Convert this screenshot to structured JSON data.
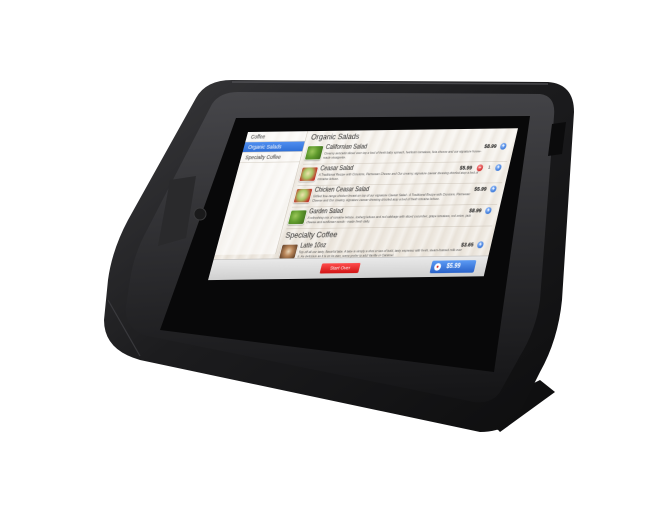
{
  "sidebar": {
    "items": [
      {
        "label": "Coffee",
        "active": false
      },
      {
        "label": "Organic Salads",
        "active": true
      },
      {
        "label": "Specialty Coffee",
        "active": false
      }
    ]
  },
  "menu": {
    "sections": [
      {
        "title": "Organic Salads",
        "items": [
          {
            "name": "Californian Salad",
            "price": "$8.99",
            "description": "Creamy avocado sliced over top a bed of fresh baby spinach, heirloom tomatoes, feta cheese and our signature house-made vinaigrette.",
            "qty": ""
          },
          {
            "name": "Ceasar Salad",
            "price": "$5.99",
            "description": "A Traditional Recipe with Croutons, Parmesan Cheese and Our creamy, signature caesar dressing drizzled atop a bed of romaine lettuce.",
            "qty": "1"
          },
          {
            "name": "Chicken Ceasar Salad",
            "price": "$5.99",
            "description": "Grilled free-range chicken breast on top of our signature Caesar Salad - A Traditional Recipe with Croutons, Parmesan Cheese and Our creamy, signature caesar dressing drizzled atop a bed of fresh romaine lettuce.",
            "qty": ""
          },
          {
            "name": "Garden Salad",
            "price": "$8.99",
            "description": "A refreshing mix of romaine lettuce, iceberg lettuce and red cabbage with sliced cucumber, grape tomatoes, red onion, jack cheese and sunflower seeds - made fresh daily.",
            "qty": ""
          }
        ]
      },
      {
        "title": "Specialty Coffee",
        "items": [
          {
            "name": "Latte 10oz",
            "price": "$3.65",
            "description": "Top off all our tasty, flavorful latte. A latte is simply a shot or two of bold, tasty espresso with fresh, steam-foamed milk over it. As delicious as it is on its own, some prefer to add Vanilla or Caramel.",
            "qty": ""
          }
        ]
      }
    ]
  },
  "footer": {
    "start_over": "Start Over",
    "cart_total": "$5.99"
  },
  "icons": {
    "add": "+",
    "remove": "−",
    "cart": "●"
  },
  "colors": {
    "accent_blue": "#2f6fd6",
    "start_over_red": "#d11414",
    "bezel": "#1d1d1f"
  }
}
